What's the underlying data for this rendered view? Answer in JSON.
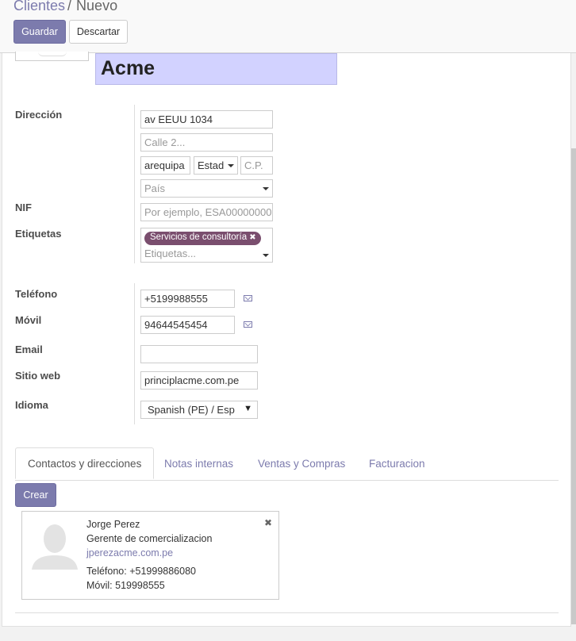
{
  "breadcrumb": {
    "parent": "Clientes",
    "separator": "/",
    "current": "Nuevo"
  },
  "toolbar": {
    "save_label": "Guardar",
    "discard_label": "Descartar"
  },
  "partner": {
    "name": "Acme"
  },
  "address": {
    "label": "Dirección",
    "street": "av EEUU 1034",
    "street2_placeholder": "Calle 2...",
    "city": "arequipa",
    "state_placeholder": "Estad",
    "zip_placeholder": "C.P.",
    "country_placeholder": "País"
  },
  "nif": {
    "label": "NIF",
    "placeholder": "Por ejemplo, ESA00000000"
  },
  "tags": {
    "label": "Etiquetas",
    "items": [
      "Servicios de consultoría"
    ],
    "placeholder": "Etiquetas...",
    "remove_glyph": "✖"
  },
  "phone": {
    "label": "Teléfono",
    "value": "+5199988555"
  },
  "mobile": {
    "label": "Móvil",
    "value": "94644545454"
  },
  "email": {
    "label": "Email",
    "value": ""
  },
  "website": {
    "label": "Sitio web",
    "value": "principlacme.com.pe"
  },
  "language": {
    "label": "Idioma",
    "value": "Spanish (PE) / Esp",
    "arrow": "▼"
  },
  "tabs": [
    {
      "label": "Contactos y direcciones",
      "active": true
    },
    {
      "label": "Notas internas",
      "active": false
    },
    {
      "label": "Ventas y Compras",
      "active": false
    },
    {
      "label": "Facturacion",
      "active": false
    }
  ],
  "contacts": {
    "create_label": "Crear",
    "items": [
      {
        "name": "Jorge Perez",
        "function": "Gerente de comercializacion",
        "email": "jperezacme.com.pe",
        "phone": "Teléfono: +51999886080",
        "mobile": "Móvil: 519998555",
        "remove_glyph": "✖"
      }
    ]
  },
  "colors": {
    "primary": "#7c7bad",
    "name_bg": "#d2d2ff",
    "tag_bg": "#7a4e6e"
  }
}
